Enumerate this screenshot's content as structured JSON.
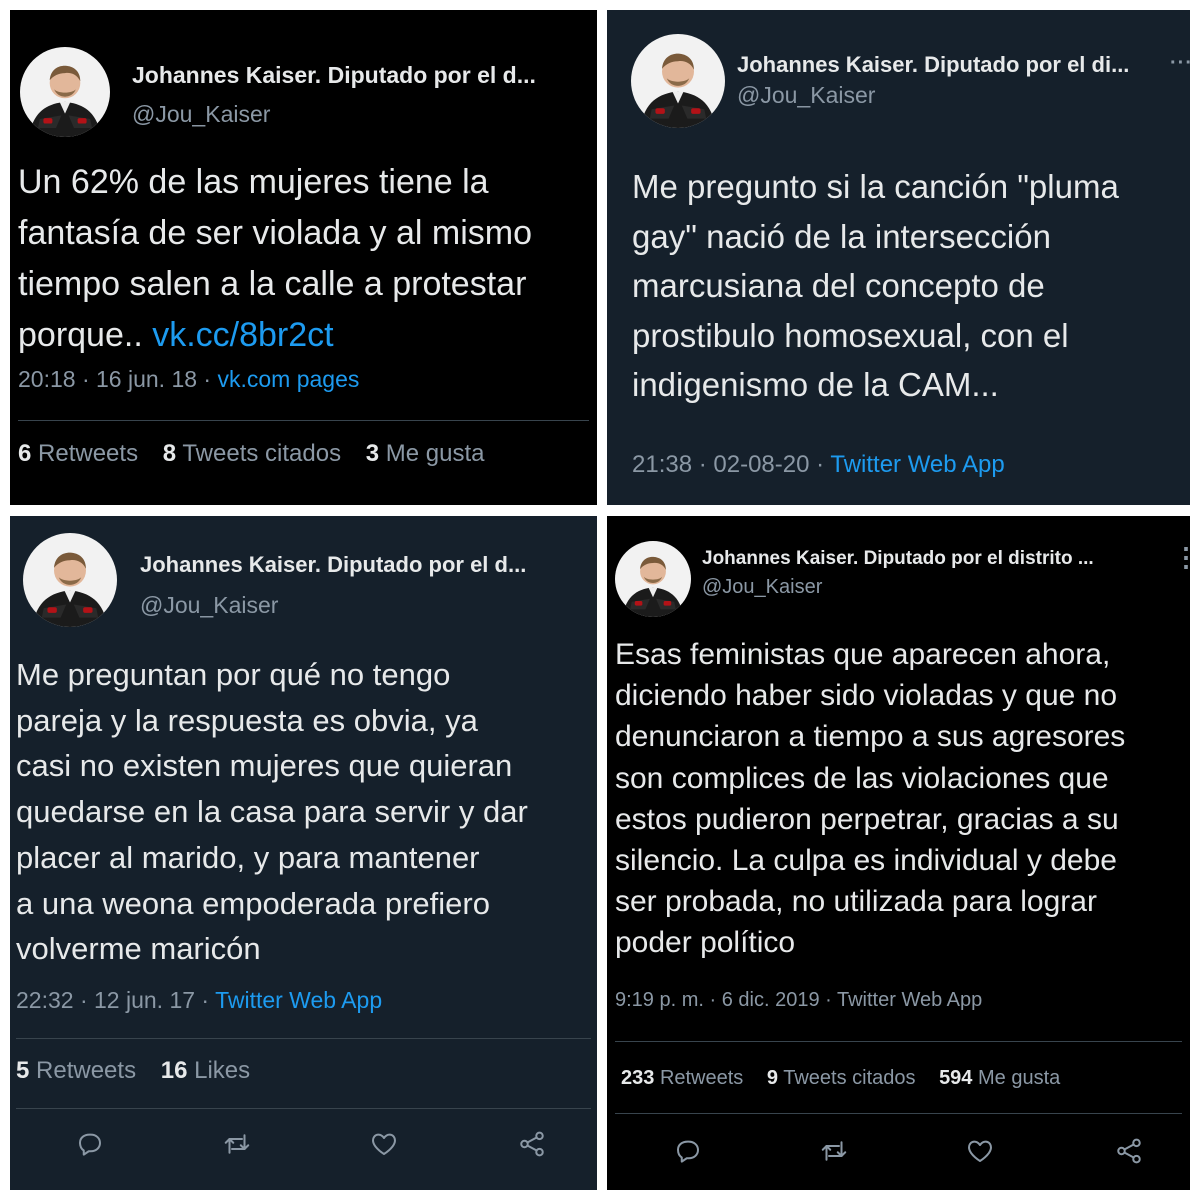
{
  "colors": {
    "link": "#1d9bf0",
    "text": "#e7e9ea",
    "muted": "#8b98a5",
    "dim_bg": "#15202b",
    "black_bg": "#000000"
  },
  "tweets": [
    {
      "name": "Johannes Kaiser. Diputado por el d...",
      "handle": "@Jou_Kaiser",
      "lines": [
        "Un 62% de las mujeres tiene la",
        "fantasía de ser violada y al mismo",
        "tiempo salen a la calle a protestar",
        "porque.. "
      ],
      "link": "vk.cc/8br2ct",
      "time": "20:18 · 16 jun. 18 · ",
      "source": "vk.com pages",
      "stats": [
        {
          "num": "6",
          "label": "Retweets"
        },
        {
          "num": "8",
          "label": "Tweets citados"
        },
        {
          "num": "3",
          "label": "Me gusta"
        }
      ]
    },
    {
      "name": "Johannes Kaiser. Diputado por el di...",
      "handle": "@Jou_Kaiser",
      "more": "···",
      "lines": [
        "Me pregunto si la canción \"pluma",
        "gay\" nació de la intersección",
        "marcusiana del concepto de",
        "prostibulo homosexual, con el",
        "indigenismo de la CAM..."
      ],
      "time": "21:38 · 02-08-20 · ",
      "source": "Twitter Web App"
    },
    {
      "name": "Johannes Kaiser. Diputado por el d...",
      "handle": "@Jou_Kaiser",
      "lines": [
        "Me preguntan por qué no tengo",
        "pareja y la respuesta es obvia, ya",
        "casi no existen mujeres que quieran",
        "quedarse en la casa para servir y dar",
        "placer al marido, y para mantener",
        "a una weona empoderada prefiero",
        "volverme maricón"
      ],
      "time": "22:32 · 12 jun. 17 · ",
      "source": "Twitter Web App",
      "stats": [
        {
          "num": "5",
          "label": "Retweets"
        },
        {
          "num": "16",
          "label": "Likes"
        }
      ],
      "actions": [
        "reply-icon",
        "retweet-icon",
        "like-icon",
        "share-icon"
      ]
    },
    {
      "name": "Johannes Kaiser. Diputado por el distrito ...",
      "handle": "@Jou_Kaiser",
      "more": "⋮",
      "lines": [
        "Esas feministas que aparecen ahora,",
        "diciendo haber sido violadas y que no",
        "denunciaron a tiempo a sus agresores",
        "son complices de las violaciones que",
        "estos pudieron perpetrar, gracias a su",
        "silencio. La culpa es individual y debe",
        "ser probada, no utilizada para lograr",
        "poder político"
      ],
      "time": "9:19 p. m. · 6 dic. 2019 · ",
      "source": "Twitter Web App",
      "stats": [
        {
          "num": "233",
          "label": "Retweets"
        },
        {
          "num": "9",
          "label": "Tweets citados"
        },
        {
          "num": "594",
          "label": "Me gusta"
        }
      ],
      "actions": [
        "reply-icon",
        "retweet-icon",
        "like-icon",
        "share-icon"
      ]
    }
  ]
}
